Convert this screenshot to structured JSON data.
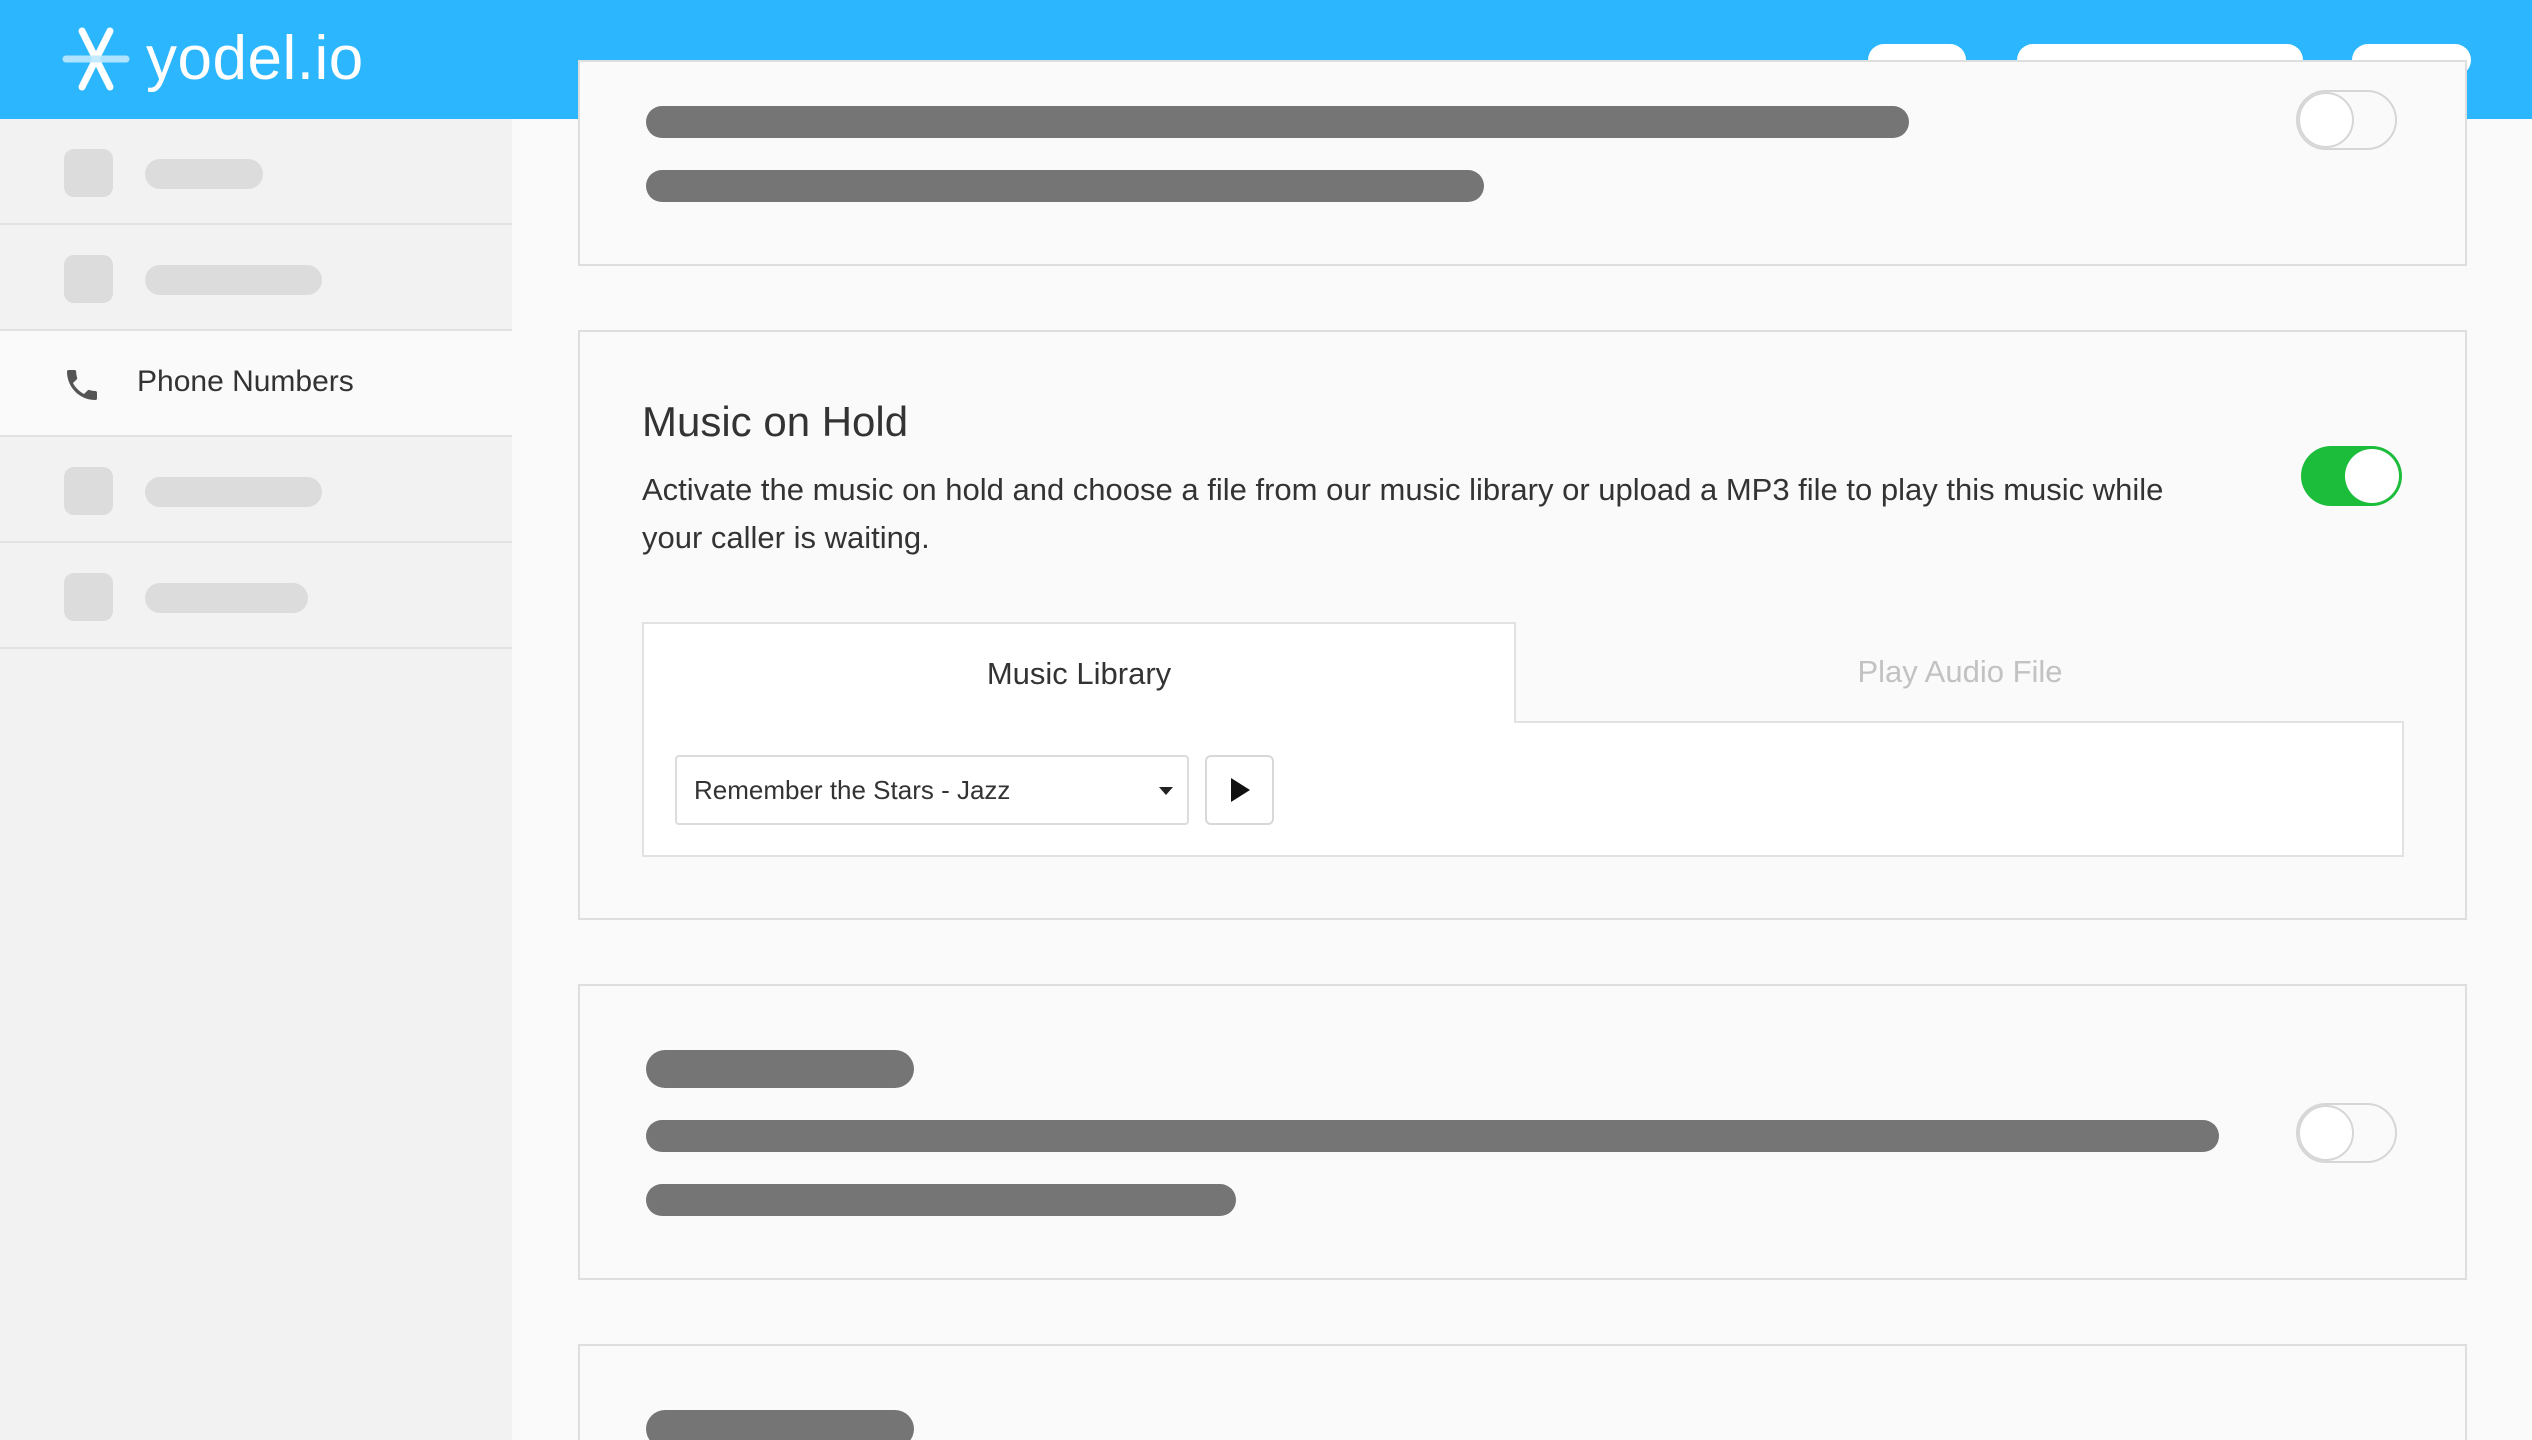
{
  "header": {
    "brand": "yodel.io",
    "brand_color": "#2bb6fd",
    "logo_icon": "yodel-logo-icon"
  },
  "sidebar": {
    "items": [
      {
        "label": "",
        "icon": "placeholder"
      },
      {
        "label": "",
        "icon": "placeholder"
      },
      {
        "label": "Phone Numbers",
        "icon": "phone-icon"
      },
      {
        "label": "",
        "icon": "placeholder"
      },
      {
        "label": "",
        "icon": "placeholder"
      }
    ]
  },
  "music_on_hold": {
    "title": "Music on Hold",
    "description": "Activate the music on hold and choose a file from our music library or upload a MP3 file to play this music while your caller is waiting.",
    "enabled": true,
    "toggle_color": "#1bbd3a",
    "tabs": [
      {
        "label": "Music Library",
        "active": true
      },
      {
        "label": "Play Audio File",
        "active": false
      }
    ],
    "selected_track": "Remember the Stars - Jazz",
    "play_icon": "play-icon"
  }
}
